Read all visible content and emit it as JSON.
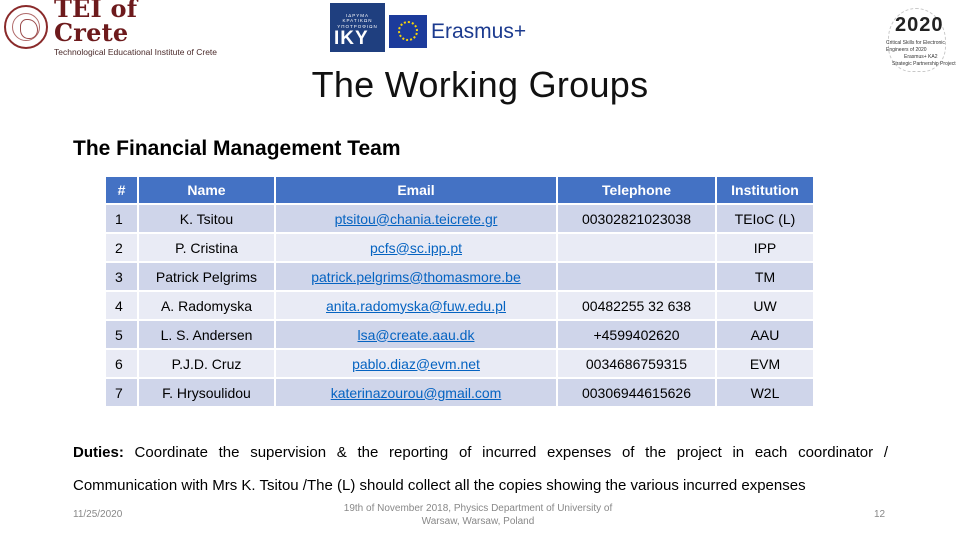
{
  "logos": {
    "tei": {
      "title": "TEI of Crete",
      "subtitle": "Technological Educational Institute of Crete"
    },
    "iky": {
      "small_lines": [
        "ΙΔΡΥΜΑ",
        "ΚΡΑΤΙΚΩΝ",
        "ΥΠΟΤΡΟΦΙΩΝ"
      ],
      "big": "IKY"
    },
    "erasmus": {
      "label": "Erasmus+"
    },
    "project2020": {
      "number": "2020",
      "lines": [
        "Critical Skills for Electronic",
        "Engineers of 2020",
        "Erasmus+ KA2",
        "Strategic Partnership Project"
      ]
    }
  },
  "page": {
    "title": "The Working Groups",
    "section_title": "The Financial Management Team"
  },
  "table": {
    "headers": [
      "#",
      "Name",
      "Email",
      "Telephone",
      "Institution"
    ],
    "rows": [
      {
        "num": "1",
        "name": "K. Tsitou",
        "email": "ptsitou@chania.teicrete.gr",
        "telephone": "00302821023038",
        "institution": "TEIoC (L)"
      },
      {
        "num": "2",
        "name": "P. Cristina",
        "email": "pcfs@sc.ipp.pt",
        "telephone": "",
        "institution": "IPP"
      },
      {
        "num": "3",
        "name": "Patrick Pelgrims",
        "email": "patrick.pelgrims@thomasmore.be",
        "telephone": "",
        "institution": "TM"
      },
      {
        "num": "4",
        "name": "A. Radomyska",
        "email": "anita.radomyska@fuw.edu.pl",
        "telephone": "00482255 32 638",
        "institution": "UW"
      },
      {
        "num": "5",
        "name": "L. S. Andersen",
        "email": "lsa@create.aau.dk",
        "telephone": "+4599402620",
        "institution": "AAU"
      },
      {
        "num": "6",
        "name": "P.J.D. Cruz",
        "email": "pablo.diaz@evm.net",
        "telephone": "0034686759315",
        "institution": "EVM"
      },
      {
        "num": "7",
        "name": "F. Hrysoulidou",
        "email": "katerinazourou@gmail.com",
        "telephone": "00306944615626",
        "institution": "W2L"
      }
    ]
  },
  "duties": {
    "label": "Duties:",
    "text": " Coordinate the supervision & the reporting of incurred expenses of the project in each coordinator / Communication with Mrs K. Tsitou /The (L) should collect all the copies showing the various incurred expenses"
  },
  "footer": {
    "date": "11/25/2020",
    "event_line1": "19th of November 2018, Physics Department of University of",
    "event_line2": "Warsaw, Warsaw, Poland",
    "page_number": "12"
  },
  "colors": {
    "header_blue": "#4472c4",
    "row_dark": "#cfd5ea",
    "row_light": "#e9ebf5",
    "link": "#0563c1",
    "tei_maroon": "#6d1a1c"
  }
}
